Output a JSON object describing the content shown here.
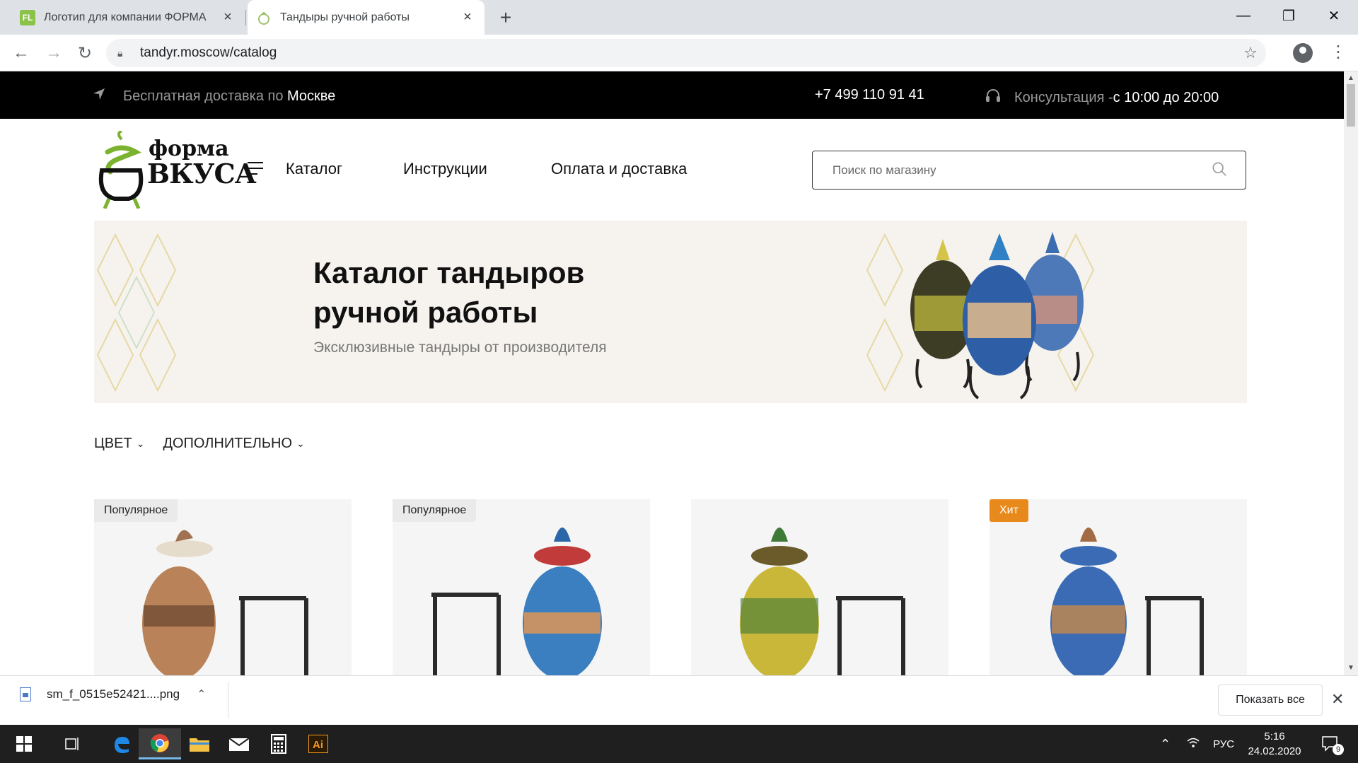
{
  "browser": {
    "tabs": [
      {
        "favicon": "FL",
        "title": "Логотип для компании ФОРМА"
      },
      {
        "favicon": "tandyr-leaf-icon",
        "title": "Тандыры ручной работы"
      }
    ],
    "new_tab": "+",
    "window_controls": {
      "minimize": "—",
      "maximize": "❐",
      "close": "✕"
    },
    "nav": {
      "back": "←",
      "forward": "→",
      "reload": "↻"
    },
    "url": "tandyr.moscow/catalog",
    "star": "☆",
    "menu": "⋮"
  },
  "topbar": {
    "delivery_prefix": "Бесплатная доставка по ",
    "delivery_city": "Москве",
    "phone": "+7 499 110 91 41",
    "consult_prefix": "Консультация - ",
    "consult_hours": "с 10:00 до 20:00"
  },
  "header": {
    "logo_word1": "форма",
    "logo_word2": "ВКУСА",
    "nav": [
      "Каталог",
      "Инструкции",
      "Оплата и доставка"
    ],
    "search_placeholder": "Поиск по магазину"
  },
  "banner": {
    "title_line1": "Каталог тандыров",
    "title_line2": "ручной работы",
    "subtitle": "Эксклюзивные тандыры от производителя"
  },
  "filters": [
    {
      "label": "ЦВЕТ"
    },
    {
      "label": "ДОПОЛНИТЕЛЬНО"
    }
  ],
  "products": [
    {
      "badge": "Популярное",
      "badge_type": "popular",
      "pot_color": "#b98258"
    },
    {
      "badge": "Популярное",
      "badge_type": "popular",
      "pot_color": "#3b7fc0"
    },
    {
      "badge": "",
      "badge_type": "none",
      "pot_color": "#c9b73a"
    },
    {
      "badge": "Хит",
      "badge_type": "hit",
      "pot_color": "#3a6bb4"
    }
  ],
  "colors": {
    "hit": "#e8891c",
    "logo_green": "#7bb32e",
    "topbar_bg": "#000000"
  },
  "download": {
    "file": "sm_f_0515e52421....png",
    "show_all": "Показать все",
    "close": "✕"
  },
  "taskbar": {
    "language": "РУС",
    "time": "5:16",
    "date": "24.02.2020",
    "notifications": "9"
  }
}
